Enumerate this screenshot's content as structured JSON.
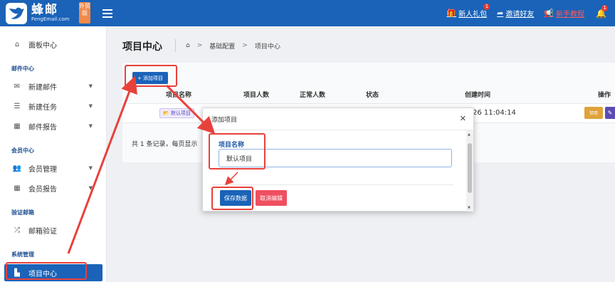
{
  "brand": {
    "name_cn": "蜂邮",
    "domain": "FengEmail.com",
    "tag": "外贸版"
  },
  "topbar": {
    "links": [
      {
        "label": "新人礼包",
        "icon": "gift-icon",
        "badge": "1",
        "color": "#ffffff"
      },
      {
        "label": "邀请好友",
        "icon": "share-icon",
        "color": "#ffffff"
      },
      {
        "label": "新手教程",
        "icon": "megaphone-icon",
        "color": "#ff5a5a"
      }
    ],
    "bell_badge": "1"
  },
  "sidebar": {
    "items": [
      {
        "label": "面板中心",
        "icon": "home-icon"
      },
      {
        "label": "新建邮件",
        "icon": "envelope-icon",
        "caret": true
      },
      {
        "label": "新建任务",
        "icon": "list-icon",
        "caret": true
      },
      {
        "label": "邮件报告",
        "icon": "chart-icon",
        "caret": true
      },
      {
        "label": "会员管理",
        "icon": "users-icon",
        "caret": true
      },
      {
        "label": "会员报告",
        "icon": "chart-icon",
        "caret": true
      },
      {
        "label": "邮箱验证",
        "icon": "shuffle-icon"
      },
      {
        "label": "项目中心",
        "icon": "project-icon",
        "active": true
      }
    ],
    "sections": [
      "邮件中心",
      "会员中心",
      "验证邮箱",
      "系统管理"
    ]
  },
  "main": {
    "title": "项目中心",
    "breadcrumb": [
      "基础配置",
      "项目中心"
    ],
    "add_button": "+ 添加项目",
    "columns": [
      "项目名称",
      "项目人数",
      "正常人数",
      "状态",
      "创建时间",
      "操作"
    ],
    "row": {
      "name": "默认项目",
      "created": "26 11:04:14",
      "disable_label": "禁用"
    },
    "footer": "共 1 条记录，每页显示"
  },
  "modal": {
    "title": "添加项目",
    "field_label": "项目名称",
    "field_value": "默认项目",
    "save_label": "保存数据",
    "cancel_label": "取消编辑"
  },
  "colors": {
    "primary": "#1a63b8",
    "danger": "#ef4f5f",
    "warning": "#e0a23a",
    "annotation": "#e8413b"
  }
}
